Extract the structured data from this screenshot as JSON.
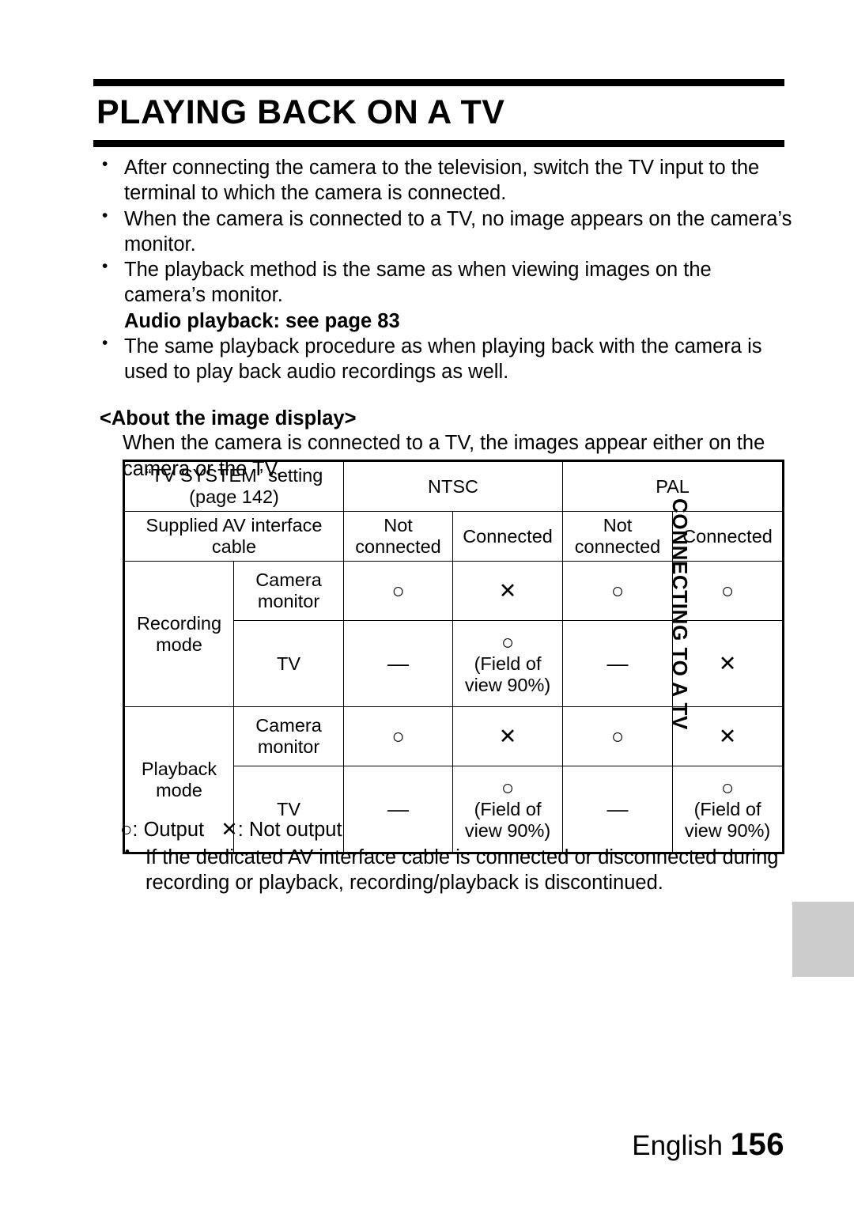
{
  "document": {
    "title": "PLAYING BACK ON A TV",
    "intro_bullets": [
      "After connecting the camera to the television, switch the TV input to the terminal to which the camera is connected.",
      "When the camera is connected to a TV, no image appears on the camera’s monitor.",
      "The playback method is the same as when viewing images on the camera’s monitor."
    ],
    "audio_note": "Audio playback: see page 83",
    "audio_bullet": "The same playback procedure as when playing back with the camera is used to play back audio recordings as well.",
    "section": {
      "heading": "<About the image display>",
      "body": "When the camera is connected to a TV, the images appear either on the camera or the TV."
    },
    "legend": "○: Output   ✕: Not output",
    "footnote": "If the dedicated AV interface cable is connected or disconnected during recording or playback, recording/playback is discontinued.",
    "side_tab": "CONNECTING TO A TV",
    "footer": {
      "language": "English",
      "page_number": "156"
    }
  },
  "table": {
    "header_row1": {
      "label": "“TV SYSTEM” setting\n(page 142)",
      "label_line1": "“TV SYSTEM” setting",
      "label_line2": "(page 142)",
      "ntsc": "NTSC",
      "pal": "PAL"
    },
    "header_row2": {
      "label_line1": "Supplied AV interface",
      "label_line2": "cable",
      "ntsc_not_connected_line1": "Not",
      "ntsc_not_connected_line2": "connected",
      "ntsc_connected": "Connected",
      "pal_not_connected_line1": "Not",
      "pal_not_connected_line2": "connected",
      "pal_connected": "Connected"
    },
    "rows": [
      {
        "mode_line1": "Recording",
        "mode_line2": "mode",
        "sub": [
          {
            "name_line1": "Camera",
            "name_line2": "monitor",
            "ntsc_not_connected": "○",
            "ntsc_connected": "✕",
            "pal_not_connected": "○",
            "pal_connected": "○"
          },
          {
            "name_line1": "TV",
            "name_line2": "",
            "ntsc_not_connected": "—",
            "ntsc_connected": "○",
            "ntsc_connected_note_line1": "(Field of",
            "ntsc_connected_note_line2": "view 90%)",
            "pal_not_connected": "—",
            "pal_connected": "✕"
          }
        ]
      },
      {
        "mode_line1": "Playback",
        "mode_line2": "mode",
        "sub": [
          {
            "name_line1": "Camera",
            "name_line2": "monitor",
            "ntsc_not_connected": "○",
            "ntsc_connected": "✕",
            "pal_not_connected": "○",
            "pal_connected": "✕"
          },
          {
            "name_line1": "TV",
            "name_line2": "",
            "ntsc_not_connected": "—",
            "ntsc_connected": "○",
            "ntsc_connected_note_line1": "(Field of",
            "ntsc_connected_note_line2": "view 90%)",
            "pal_not_connected": "—",
            "pal_connected": "○",
            "pal_connected_note_line1": "(Field of",
            "pal_connected_note_line2": "view 90%)"
          }
        ]
      }
    ]
  }
}
